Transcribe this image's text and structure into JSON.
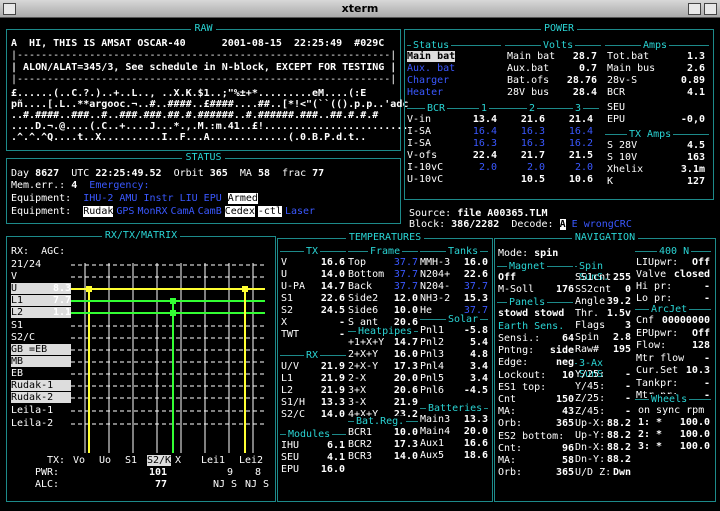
{
  "window": {
    "title": "xterm"
  },
  "raw": {
    "title": "RAW",
    "header": "A  HI, THIS IS AMSAT OSCAR-40      2001-08-15  22:25:49  #029C",
    "bar": "|--------------------------------------------------------------|",
    "message": "| ALON/ALAT=345/3, See schedule in N-block, EXCEPT FOR TESTING |",
    "dump": [
      "£......(..C.?.)..+..L.., ..X.K.$1..;\"%±+*.........eM....(:E",
      "pñ....[.L..**argooc.¬..#..####..£####....##..[*!<\"(``(()­.p.p..'adc",
      "..#.####..###..#..###.###.##.#.######..#.######.###..##.#.#.#",
      "....D.¬.@....(.C..+....J...*.,.M.:m.41..£!........................",
      ".^.^.^Q....t..X..........I..F...A.............(.0.B.P.d.t.."
    ]
  },
  "power": {
    "title": "POWER",
    "status_title": "Status",
    "volts_title": "Volts",
    "amps_title": "Amps",
    "status": [
      {
        "label": "Main bat",
        "active": true
      },
      {
        "label": "Aux. bat",
        "active": false
      },
      {
        "label": "Charger",
        "active": false
      },
      {
        "label": "Heater",
        "active": false
      }
    ],
    "volts": [
      [
        "Main bat",
        "28.7"
      ],
      [
        "Aux.bat",
        "0.7"
      ],
      [
        "Bat.ofs",
        "28.76"
      ],
      [
        "28V bus",
        "28.4"
      ]
    ],
    "amps": [
      [
        "Tot.bat",
        "1.3"
      ],
      [
        "Main bus",
        "2.6"
      ],
      [
        "28v-S",
        "0.89"
      ],
      [
        "BCR",
        "4.1"
      ]
    ],
    "bcr_title": "BCR",
    "bcr_cols": [
      "1",
      "2",
      "3"
    ],
    "bcr": [
      [
        "V-in",
        "13.4",
        "21.6",
        "21.4"
      ],
      [
        "I-SA",
        "16.4",
        "16.3",
        "16.4"
      ],
      [
        "I-SA",
        "16.3",
        "16.3",
        "16.2"
      ],
      [
        "V-ofs",
        "22.4",
        "21.7",
        "21.5"
      ],
      [
        "I-10vC",
        "2.0",
        "2.0",
        "2.0"
      ],
      [
        "U-10vC",
        "",
        "10.5",
        "10.6"
      ]
    ],
    "seu": [
      [
        "SEU",
        "",
        ""
      ],
      [
        "EPU",
        "-0,0",
        ""
      ]
    ],
    "txamps_title": "TX Amps",
    "txamps": [
      [
        "S 28V",
        "4.5"
      ],
      [
        "S 10V",
        "163"
      ],
      [
        "Xhelix",
        "3.1m"
      ],
      [
        "K",
        "127"
      ]
    ]
  },
  "source": {
    "label": "Source:",
    "value": "file A00365.TLM",
    "block_label": "Block:",
    "block": "386/2282",
    "decode_label": "Decode:",
    "decode_val": "A",
    "decode_e": "E",
    "decode_status": "wrongCRC"
  },
  "status": {
    "title": "STATUS",
    "day_label": "Day",
    "day": "8627",
    "utc_label": "UTC",
    "utc": "22:25:49.52",
    "orbit_label": "Orbit",
    "orbit": "365",
    "ma_label": "MA",
    "ma": "58",
    "frac_label": "frac",
    "frac": "77",
    "memerr_label": "Mem.err.:",
    "memerr": "4",
    "emergency": "Emergency:",
    "equip_label": "Equipment:",
    "equip1": "IHU-2 AMU Instr LIU EPU",
    "armed": "Armed",
    "equip2": [
      "Rudak",
      "GPS",
      "MonRX",
      "CamA",
      "CamB",
      "Cedex",
      "-ctl",
      "Laser"
    ]
  },
  "matrix": {
    "title": "RX/TX/MATRIX",
    "rx": "RX:",
    "agc": "AGC:",
    "rows": [
      [
        "21/24",
        ""
      ],
      [
        "V",
        ""
      ],
      [
        "U",
        "8.3"
      ],
      [
        "L1",
        "7.7"
      ],
      [
        "L2",
        "1.1"
      ],
      [
        "S1",
        ""
      ],
      [
        "S2/C",
        ""
      ],
      [
        "GB =EB",
        ""
      ],
      [
        "MB",
        ""
      ],
      [
        "EB",
        ""
      ],
      [
        "Rudak-1",
        ""
      ],
      [
        "Rudak-2",
        ""
      ],
      [
        "Leila-1",
        ""
      ],
      [
        "Leila-2",
        ""
      ]
    ],
    "tx_label": "TX:",
    "tx_cols": [
      "Vo",
      "Uo",
      "S1",
      "S2/K",
      "X",
      "Lei1",
      "Lei2"
    ],
    "pwr_label": "PWR:",
    "pwr": "101",
    "pwr_a": "9",
    "pwr_b": "8",
    "alc_label": "ALC:",
    "alc": "77",
    "alc_a": "NJ S",
    "alc_b": "NJ S"
  },
  "temps": {
    "title": "TEMPERATURES",
    "tx_title": "TX",
    "tx": [
      [
        "V",
        "16.6"
      ],
      [
        "U",
        "14.0"
      ],
      [
        "U-PA",
        "14.7"
      ],
      [
        "S1",
        "22.6"
      ],
      [
        "S2",
        "24.5"
      ],
      [
        "X",
        "-"
      ],
      [
        "TWT",
        "-"
      ]
    ],
    "rx_title": "RX",
    "rx": [
      [
        "U/V",
        "21.9"
      ],
      [
        "L1",
        "21.9"
      ],
      [
        "L2",
        "21.9"
      ],
      [
        "S1/H",
        "13.3"
      ],
      [
        "S2/C",
        "14.0"
      ]
    ],
    "mod_title": "Modules",
    "mod": [
      [
        "IHU",
        "6.1"
      ],
      [
        "SEU",
        "4.1"
      ],
      [
        "EPU",
        "16.0"
      ]
    ],
    "frame_title": "Frame",
    "frame": [
      [
        "Top",
        "37.7"
      ],
      [
        "Bottom",
        "37.7"
      ],
      [
        "Back",
        "37.7"
      ],
      [
        "Side2",
        "12.0"
      ],
      [
        "Side6",
        "10.0"
      ],
      [
        "S ant",
        "20.6"
      ]
    ],
    "heat_title": "Heatpipes",
    "heat": [
      [
        "+1+X+Y",
        "14.7"
      ],
      [
        "2+X+Y",
        "16.0"
      ],
      [
        "2+X-Y",
        "17.3"
      ],
      [
        "2-X",
        "20.0"
      ],
      [
        "3+X",
        "20.6"
      ],
      [
        "3-X",
        "21.9"
      ],
      [
        "4+X+Y",
        "23.2"
      ]
    ],
    "bat_title": "Bat.Reg.",
    "bat": [
      [
        "BCR1",
        "10.0"
      ],
      [
        "BCR2",
        "17.3"
      ],
      [
        "BCR3",
        "14.0"
      ]
    ],
    "tanks_title": "Tanks",
    "tanks": [
      [
        "MMH-3",
        "16.0"
      ],
      [
        "N204+",
        "22.6"
      ],
      [
        "N204-",
        "37.7"
      ],
      [
        "NH3-2",
        "15.3"
      ],
      [
        "He",
        "37.7"
      ]
    ],
    "solar_title": "Solar",
    "solar": [
      [
        "Pnl1",
        "-5.8"
      ],
      [
        "Pnl2",
        "5.4"
      ],
      [
        "Pnl3",
        "4.8"
      ],
      [
        "Pnl4",
        "3.4"
      ],
      [
        "Pnl5",
        "3.4"
      ],
      [
        "Pnl6",
        "-4.5"
      ]
    ],
    "batt_title": "Batteries",
    "batt": [
      [
        "Main3",
        "13.3"
      ],
      [
        "Main4",
        "20.0"
      ],
      [
        "Aux1",
        "16.6"
      ],
      [
        "Aux5",
        "18.6"
      ]
    ]
  },
  "nav": {
    "title": "NAVIGATION",
    "mode_label": "Mode:",
    "mode": "spin",
    "magnet_title": "Magnet",
    "magnet_off": "Off",
    "msoll_label": "M-Soll",
    "msoll": "176",
    "panels_title": "Panels",
    "panels": "stowd stowd",
    "earth": "Earth Sens.",
    "left": [
      [
        "Sensi.:",
        "64"
      ],
      [
        "Pntng:",
        "side"
      ],
      [
        "Edge:",
        "neg"
      ],
      [
        "Lockout:",
        "10"
      ],
      [
        "ES1 top:",
        ""
      ],
      [
        "Cnt",
        "150"
      ],
      [
        "MA:",
        "43"
      ],
      [
        "Orb:",
        "365"
      ],
      [
        "ES2 bottom:",
        ""
      ],
      [
        "Cnt:",
        "96"
      ],
      [
        "MA:",
        "58"
      ],
      [
        "Orb:",
        "365"
      ]
    ],
    "spin_title": "Spin SunS.",
    "spin": [
      [
        "SS1cnt",
        "255"
      ],
      [
        "SS2cnt",
        "0"
      ],
      [
        "Angle",
        "39.2"
      ],
      [
        "Thr.",
        "1.5v"
      ],
      [
        "Flags",
        "3"
      ],
      [
        "Spin",
        "2.8"
      ],
      [
        "Raw#",
        "195"
      ]
    ],
    "axis_title": "3-Ax SunS",
    "axis": [
      [
        "Y/25:",
        "-"
      ],
      [
        "Y/45:",
        "-"
      ],
      [
        "Z/25:",
        "-"
      ],
      [
        "Z/45:",
        "-"
      ],
      [
        "Up-X:",
        "88.2"
      ],
      [
        "Up-Y:",
        "88.2"
      ],
      [
        "Dn-X:",
        "88.2"
      ],
      [
        "Dn-Y:",
        "88.2"
      ],
      [
        "U/D Z:",
        "Dwn"
      ]
    ],
    "n400_title": "400 N",
    "n400": [
      [
        "LIUpwr:",
        "Off"
      ],
      [
        "Valve",
        "closed"
      ],
      [
        "Hi pr:",
        "-"
      ],
      [
        "Lo pr:",
        "-"
      ]
    ],
    "arcjet_title": "ArcJet",
    "arcjet": [
      [
        "Cnf",
        "00000000"
      ],
      [
        "EPUpwr:",
        "Off"
      ],
      [
        "Flow:",
        "128"
      ],
      [
        "Mtr flow",
        "-"
      ],
      [
        "Cur.Set",
        "10.3"
      ],
      [
        "Tankpr:",
        "-"
      ],
      [
        "Mtr.pr:",
        "-"
      ]
    ],
    "wheels_title": "Wheels",
    "wheels_sync": "on sync rpm",
    "wheels": [
      [
        "1:",
        "*",
        "100.0"
      ],
      [
        "2:",
        "*",
        "100.0"
      ],
      [
        "3:",
        "*",
        "100.0"
      ]
    ]
  },
  "colors": {
    "frame": "#1d8a8a",
    "cyan": "#2ad4d4",
    "blue": "#3a58ff",
    "yellow": "#ffff33",
    "green": "#33ff33"
  }
}
